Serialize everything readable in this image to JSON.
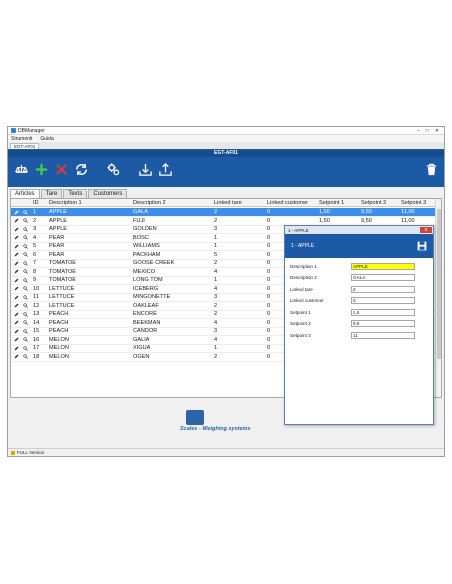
{
  "window": {
    "title": "DBManager",
    "menu": [
      "Strumenti",
      "Guida"
    ],
    "doc_tab": "EGT-AF01"
  },
  "ribbon": {
    "title": "EGT-AF01"
  },
  "tabs": [
    "Articles",
    "Tare",
    "Texts",
    "Customers"
  ],
  "table": {
    "columns": [
      "ID",
      "Description 1",
      "Description 2",
      "Linked tare",
      "Linked customer",
      "Setpoint 1",
      "Setpoint 2",
      "Setpoint 3"
    ],
    "rows": [
      [
        "1",
        "APPLE",
        "GALA",
        "2",
        "0",
        "1,50",
        "9,50",
        "11,00"
      ],
      [
        "2",
        "APPLE",
        "FUJI",
        "2",
        "0",
        "1,50",
        "9,50",
        "11,00"
      ],
      [
        "3",
        "APPLE",
        "GOLDEN",
        "3",
        "0",
        "",
        "",
        ""
      ],
      [
        "4",
        "PEAR",
        "BOSC",
        "1",
        "0",
        "",
        "",
        ""
      ],
      [
        "5",
        "PEAR",
        "WILLIAMS",
        "1",
        "0",
        "",
        "",
        ""
      ],
      [
        "6",
        "PEAR",
        "PACKHAM",
        "5",
        "0",
        "",
        "",
        ""
      ],
      [
        "7",
        "TOMATOE",
        "GOOSE CREEK",
        "2",
        "0",
        "",
        "",
        ""
      ],
      [
        "8",
        "TOMATOE",
        "MEXICO",
        "4",
        "0",
        "",
        "",
        ""
      ],
      [
        "9",
        "TOMATOE",
        "LONG TOM",
        "1",
        "0",
        "",
        "",
        ""
      ],
      [
        "10",
        "LETTUCE",
        "ICEBERG",
        "4",
        "0",
        "",
        "",
        ""
      ],
      [
        "11",
        "LETTUCE",
        "MINGONETTE",
        "3",
        "0",
        "",
        "",
        ""
      ],
      [
        "12",
        "LETTUCE",
        "OAKLEAF",
        "2",
        "0",
        "",
        "",
        ""
      ],
      [
        "13",
        "PEACH",
        "ENCORE",
        "2",
        "0",
        "",
        "",
        ""
      ],
      [
        "14",
        "PEACH",
        "BEEKMAN",
        "4",
        "0",
        "",
        "",
        ""
      ],
      [
        "15",
        "PEACH",
        "CANDOR",
        "3",
        "0",
        "",
        "",
        ""
      ],
      [
        "16",
        "MELON",
        "GALIA",
        "4",
        "0",
        "",
        "",
        ""
      ],
      [
        "17",
        "MELON",
        "XIGUA",
        "1",
        "0",
        "",
        "",
        ""
      ],
      [
        "18",
        "MELON",
        "OGEN",
        "2",
        "0",
        "",
        "",
        ""
      ]
    ]
  },
  "brand": {
    "text": "Scales - Weighing systems"
  },
  "status": {
    "text": "FULL Version"
  },
  "dialog": {
    "title": "1 - APPLE",
    "header": "1 - APPLE",
    "close": "X",
    "fields": [
      {
        "label": "Description 1",
        "value": "APPLE"
      },
      {
        "label": "Description 2",
        "value": "GALA"
      },
      {
        "label": "Linked tare",
        "value": "2"
      },
      {
        "label": "Linked customer",
        "value": "0"
      },
      {
        "label": "Setpoint 1",
        "value": "1,5"
      },
      {
        "label": "Setpoint 2",
        "value": "9,5"
      },
      {
        "label": "Setpoint 3",
        "value": "11"
      }
    ]
  },
  "colors": {
    "ribbon": "#1d5aa6",
    "selected_row": "#3d8ee8",
    "add_icon": "#3fcf3f",
    "delete_icon": "#e03a3a",
    "highlight_field": "#ffff00"
  },
  "icons": [
    "scale-icon",
    "add-icon",
    "delete-icon",
    "refresh-icon",
    "settings-icon",
    "import-icon",
    "export-icon",
    "trash-icon",
    "edit-icon",
    "view-icon",
    "save-icon"
  ]
}
